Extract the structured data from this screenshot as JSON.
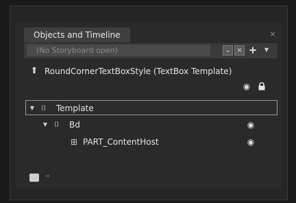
{
  "panel": {
    "title": "Objects and Timeline",
    "close_glyph": "×"
  },
  "storyboard": {
    "placeholder": "(No Storyboard open)",
    "pin_glyph": "⌄",
    "close_glyph": "×",
    "add_glyph": "+",
    "menu_glyph": "▼"
  },
  "scope": {
    "icon": "scope-up-icon",
    "up_glyph": "⬆",
    "label": "RoundCornerTextBoxStyle (TextBox Template)",
    "eye_glyph": "◉"
  },
  "tree": [
    {
      "label": "Template",
      "expand_glyph": "▼",
      "elem_glyph": "⟨⟩",
      "selected": true
    },
    {
      "label": "Bd",
      "expand_glyph": "▼",
      "elem_glyph": "⟨⟩",
      "eye_glyph": "◉"
    },
    {
      "label": "PART_ContentHost",
      "icon_glyph": "⊞",
      "eye_glyph": "◉"
    }
  ],
  "bottom": {
    "arrow_glyph": "◄"
  }
}
